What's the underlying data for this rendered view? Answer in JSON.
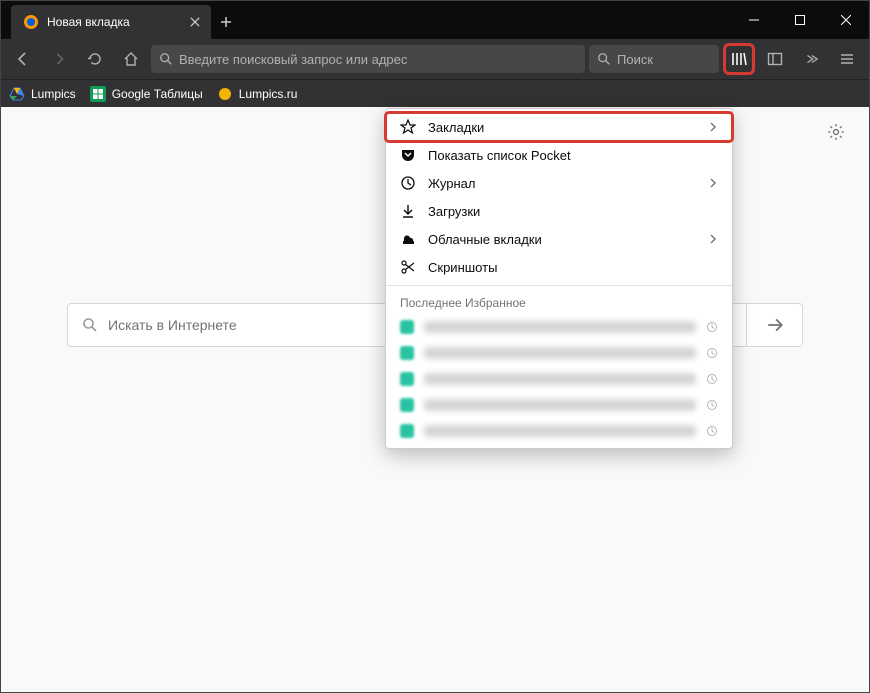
{
  "tab": {
    "title": "Новая вкладка"
  },
  "urlbar": {
    "placeholder": "Введите поисковый запрос или адрес"
  },
  "searchbar": {
    "placeholder": "Поиск"
  },
  "bookmarks_toolbar": {
    "items": [
      {
        "label": "Lumpics",
        "color": "#4285f4"
      },
      {
        "label": "Google Таблицы",
        "color": "#0f9d58"
      },
      {
        "label": "Lumpics.ru",
        "color": "#f4b400"
      }
    ]
  },
  "newtab": {
    "search_placeholder": "Искать в Интернете"
  },
  "library_panel": {
    "items": [
      {
        "icon": "star",
        "label": "Закладки",
        "chevron": true,
        "highlight": true
      },
      {
        "icon": "pocket",
        "label": "Показать список Pocket"
      },
      {
        "icon": "history",
        "label": "Журнал",
        "chevron": true
      },
      {
        "icon": "download",
        "label": "Загрузки"
      },
      {
        "icon": "cloud",
        "label": "Облачные вкладки",
        "chevron": true
      },
      {
        "icon": "scissors",
        "label": "Скриншоты"
      }
    ],
    "recent_header": "Последнее Избранное",
    "recent_count": 5
  }
}
